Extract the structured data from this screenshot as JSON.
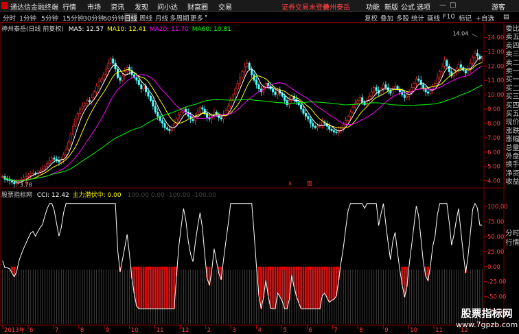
{
  "menubar": {
    "app_title": "通达信金融终端",
    "menu": [
      "行情",
      "市场",
      "资讯",
      "发现",
      "问小达",
      "财富圈",
      "交易"
    ],
    "notice": "证券交易未登录",
    "stock_name": "神州泰岳",
    "right_menu": [
      "功能",
      "新版",
      "公式",
      "选项"
    ],
    "user": "游客"
  },
  "toolbar": {
    "periods": [
      "分时",
      "1分钟",
      "5分钟",
      "15分钟",
      "30分钟",
      "60分钟",
      "日线",
      "周线",
      "月线",
      "多周期",
      "更多"
    ],
    "active": "日线",
    "right_tools": [
      "复权",
      "叠加",
      "多股",
      "统计",
      "画线",
      "F10",
      "标记",
      "+自选"
    ]
  },
  "colors": {
    "ma5": "#ffffff",
    "ma10": "#ffff00",
    "ma20": "#ff00ff",
    "ma60": "#00ff00",
    "up": "#ff3232",
    "down": "#54ffff",
    "accent": "#ff3232",
    "grid": "#7a0000"
  },
  "main_legend": {
    "title": "神州泰岳(日线 前复权)",
    "ma5": "MA5: 12.57",
    "ma10": "MA10: 12.41",
    "ma20": "MA20: 11.70",
    "ma60": "MA60: 10.81"
  },
  "sub_legend": {
    "title": "股票指标网",
    "cci": "CCI: 12.42",
    "main": "主力潜伏中: 0.00",
    "levels": "100.00   0.00   -100.00   -100.00"
  },
  "markers": [
    "$",
    "$",
    "窗"
  ],
  "side_panel_top": [
    "委比",
    "卖五",
    "卖四",
    "卖三",
    "卖二",
    "卖一",
    "买一",
    "买二",
    "买三",
    "买四",
    "买五",
    "现价",
    "涨跌",
    "涨幅",
    "总量",
    "外盘",
    "换手",
    "净资",
    "收益"
  ],
  "side_panel_bottom": [
    "分时",
    "行情"
  ],
  "watermark": {
    "title": "股票指标网",
    "url": "www.7gpzb.com"
  },
  "chart_data": [
    {
      "type": "line",
      "title": "",
      "subtype": "candlestick",
      "y_axis": {
        "ticks": [
          "14.00",
          "13.00",
          "12.00",
          "11.00",
          "10.00",
          "9.00",
          "8.00",
          "7.00",
          "6.00",
          "5.00",
          "4.00"
        ],
        "ylim": [
          3.6,
          14.5
        ]
      },
      "annotations": [
        {
          "text": "14.04",
          "value": 14.04
        },
        {
          "text": "3.78",
          "value": 3.78
        }
      ],
      "x_axis": {
        "ticks": [
          "2013年",
          "6",
          "7",
          "8",
          "9",
          "10",
          "11",
          "12",
          "2",
          "3",
          "4",
          "5",
          "6",
          "7",
          "8",
          "9",
          "10",
          "11",
          "12"
        ]
      },
      "close": [
        4.3,
        4.1,
        4.05,
        4.0,
        3.9,
        3.8,
        3.85,
        4.0,
        4.1,
        4.2,
        4.3,
        4.4,
        4.5,
        4.55,
        4.5,
        4.6,
        4.7,
        4.8,
        5.0,
        5.2,
        5.4,
        5.6,
        5.5,
        5.4,
        5.3,
        5.5,
        5.8,
        6.2,
        6.7,
        7.2,
        7.8,
        8.3,
        8.7,
        9.0,
        9.2,
        9.4,
        9.6,
        9.5,
        9.8,
        10.2,
        10.6,
        10.9,
        11.1,
        11.4,
        11.8,
        12.2,
        12.5,
        12.2,
        11.8,
        11.2,
        11.0,
        11.3,
        11.6,
        11.9,
        11.7,
        11.4,
        11.2,
        11.0,
        10.7,
        10.4,
        10.6,
        10.2,
        9.9,
        9.6,
        9.2,
        8.8,
        8.5,
        8.2,
        8.0,
        7.7,
        7.6,
        7.5,
        7.7,
        8.0,
        8.3,
        8.6,
        8.8,
        9.0,
        8.8,
        8.5,
        8.3,
        8.2,
        8.5,
        8.8,
        9.1,
        9.0,
        8.7,
        8.4,
        8.3,
        8.5,
        8.8,
        8.6,
        8.4,
        8.3,
        8.6,
        8.9,
        9.2,
        9.6,
        10.0,
        10.4,
        10.8,
        11.2,
        11.6,
        12.0,
        12.2,
        11.8,
        11.4,
        11.0,
        10.7,
        10.4,
        10.2,
        10.5,
        10.8,
        10.6,
        10.4,
        10.2,
        10.0,
        10.3,
        10.1,
        9.9,
        9.6,
        9.3,
        9.6,
        9.9,
        9.7,
        9.5,
        9.3,
        9.0,
        8.7,
        8.5,
        8.3,
        8.0,
        7.8,
        7.7,
        7.8,
        7.9,
        8.1,
        8.0,
        7.8,
        7.6,
        7.5,
        7.4,
        7.35,
        7.5,
        7.7,
        7.9,
        8.2,
        8.5,
        8.8,
        9.1,
        9.4,
        9.6,
        9.8,
        9.5,
        9.3,
        9.6,
        9.9,
        10.2,
        10.5,
        10.3,
        10.1,
        10.4,
        10.7,
        10.5,
        10.3,
        10.1,
        10.4,
        10.6,
        10.4,
        10.2,
        10.0,
        9.8,
        9.9,
        10.2,
        10.5,
        10.8,
        11.1,
        11.0,
        10.7,
        10.4,
        10.2,
        10.1,
        10.3,
        10.6,
        10.8,
        11.2,
        11.6,
        12.0,
        12.4,
        12.0,
        11.6,
        11.3,
        11.5,
        11.8,
        12.1,
        11.9,
        11.7,
        11.5,
        11.8,
        12.2,
        12.6,
        12.9,
        12.7,
        12.5,
        12.57
      ],
      "series": [
        {
          "name": "MA5",
          "period": 5
        },
        {
          "name": "MA10",
          "period": 10
        },
        {
          "name": "MA20",
          "period": 20
        },
        {
          "name": "MA60",
          "period": 60
        }
      ]
    },
    {
      "type": "line",
      "title": "",
      "subtype": "oscillator",
      "y_axis": {
        "ticks": [
          "100.00",
          "75.00",
          "50.00",
          "25.00",
          "0.00",
          "-25.00",
          "-50.00",
          "-75.00"
        ],
        "ylim": [
          -95,
          115
        ]
      },
      "cci_smooth_factor": 12
    }
  ]
}
